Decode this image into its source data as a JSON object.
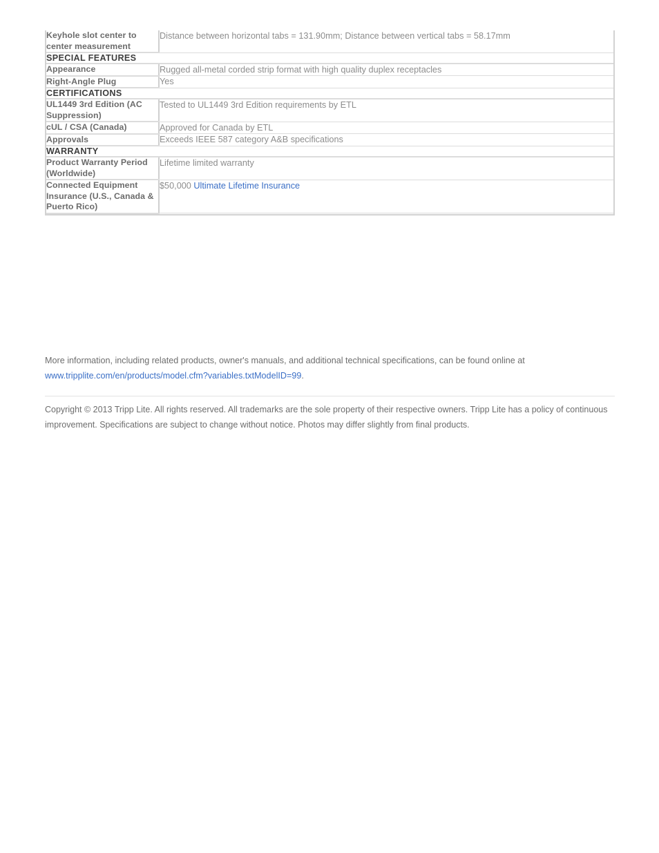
{
  "document": {
    "type": "product-specification-sheet",
    "brand": "Tripp Lite"
  },
  "spec_table": {
    "rows": [
      {
        "kind": "data",
        "label": "Keyhole slot center to center measurement",
        "value": "Distance between horizontal tabs = 131.90mm; Distance between vertical tabs = 58.17mm"
      },
      {
        "kind": "section",
        "label": "SPECIAL FEATURES"
      },
      {
        "kind": "data",
        "label": "Appearance",
        "value": "Rugged all-metal corded strip format with high quality duplex receptacles"
      },
      {
        "kind": "data",
        "label": "Right-Angle Plug",
        "value": "Yes"
      },
      {
        "kind": "section",
        "label": "CERTIFICATIONS"
      },
      {
        "kind": "data",
        "label": "UL1449 3rd Edition (AC Suppression)",
        "value": "Tested to UL1449 3rd Edition requirements by ETL"
      },
      {
        "kind": "data",
        "label": "cUL / CSA (Canada)",
        "value": "Approved for Canada by ETL"
      },
      {
        "kind": "data",
        "label": "Approvals",
        "value": "Exceeds IEEE 587 category A&B specifications"
      },
      {
        "kind": "section",
        "label": "WARRANTY"
      },
      {
        "kind": "data",
        "label": "Product Warranty Period (Worldwide)",
        "value": "Lifetime limited warranty"
      },
      {
        "kind": "data-link",
        "label": "Connected Equipment Insurance (U.S., Canada & Puerto Rico)",
        "value_prefix": "$50,000 ",
        "value_link": "Ultimate Lifetime Insurance"
      }
    ]
  },
  "footer": {
    "more_info_text": "More information, including related products, owner's manuals, and additional technical specifications, can be found online at ",
    "more_info_url_text": "www.tripplite.com/en/products/model.cfm?variables.txtModelID=99",
    "more_info_suffix": ".",
    "copyright": "Copyright © 2013 Tripp Lite. All rights reserved. All trademarks are the sole property of their respective owners. Tripp Lite has a policy of continuous improvement. Specifications are subject to change without notice. Photos may differ slightly from final products."
  },
  "colors": {
    "link": "#3b6fc6",
    "label_text": "#6b6b6b",
    "value_text": "#8d8d8d",
    "section_text": "#3d3d3d",
    "border": "#dcdcdc"
  }
}
